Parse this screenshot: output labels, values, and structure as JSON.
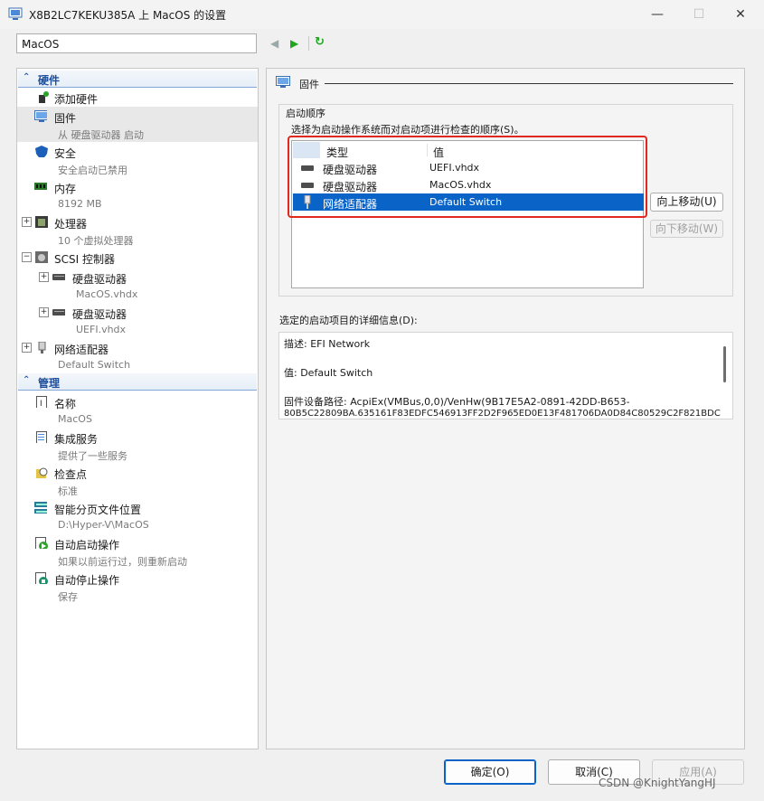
{
  "window": {
    "title": "X8B2LC7KEKU385A 上 MacOS 的设置"
  },
  "vm_select": {
    "value": "MacOS"
  },
  "tree": {
    "hardware_header": "硬件",
    "management_header": "管理",
    "items": [
      {
        "name": "添加硬件",
        "sub": ""
      },
      {
        "name": "固件",
        "sub": "从 硬盘驱动器 启动"
      },
      {
        "name": "安全",
        "sub": "安全启动已禁用"
      },
      {
        "name": "内存",
        "sub": "8192 MB"
      },
      {
        "name": "处理器",
        "sub": "10 个虚拟处理器"
      },
      {
        "name": "SCSI 控制器",
        "sub": ""
      },
      {
        "name": "硬盘驱动器",
        "sub": "MacOS.vhdx"
      },
      {
        "name": "硬盘驱动器",
        "sub": "UEFI.vhdx"
      },
      {
        "name": "网络适配器",
        "sub": "Default Switch"
      }
    ],
    "mgmt_items": [
      {
        "name": "名称",
        "sub": "MacOS"
      },
      {
        "name": "集成服务",
        "sub": "提供了一些服务"
      },
      {
        "name": "检查点",
        "sub": "标准"
      },
      {
        "name": "智能分页文件位置",
        "sub": "D:\\Hyper-V\\MacOS"
      },
      {
        "name": "自动启动操作",
        "sub": "如果以前运行过，则重新启动"
      },
      {
        "name": "自动停止操作",
        "sub": "保存"
      }
    ]
  },
  "firmware": {
    "header": "固件",
    "boot_group": "启动顺序",
    "boot_desc": "选择为启动操作系统而对启动项进行检查的顺序(S)。",
    "col_type": "类型",
    "col_value": "值",
    "boot_rows": [
      {
        "type": "硬盘驱动器",
        "value": "UEFI.vhdx"
      },
      {
        "type": "硬盘驱动器",
        "value": "MacOS.vhdx"
      },
      {
        "type": "网络适配器",
        "value": "Default Switch"
      }
    ],
    "move_up": "向上移动(U)",
    "move_down": "向下移动(W)",
    "details_label": "选定的启动项目的详细信息(D):",
    "details": {
      "desc": "描述: EFI Network",
      "value": "值: Default Switch",
      "path1": "固件设备路径: AcpiEx(VMBus,0,0)/VenHw(9B17E5A2-0891-42DD-B653-",
      "path2": "80B5C22809BA.635161F83EDFC546913FF2D2F965ED0E13F481706DA0D84C80529C2F821BDC"
    }
  },
  "footer": {
    "ok": "确定(O)",
    "cancel": "取消(C)",
    "apply": "应用(A)"
  },
  "watermark": "CSDN @KnightYangHJ"
}
